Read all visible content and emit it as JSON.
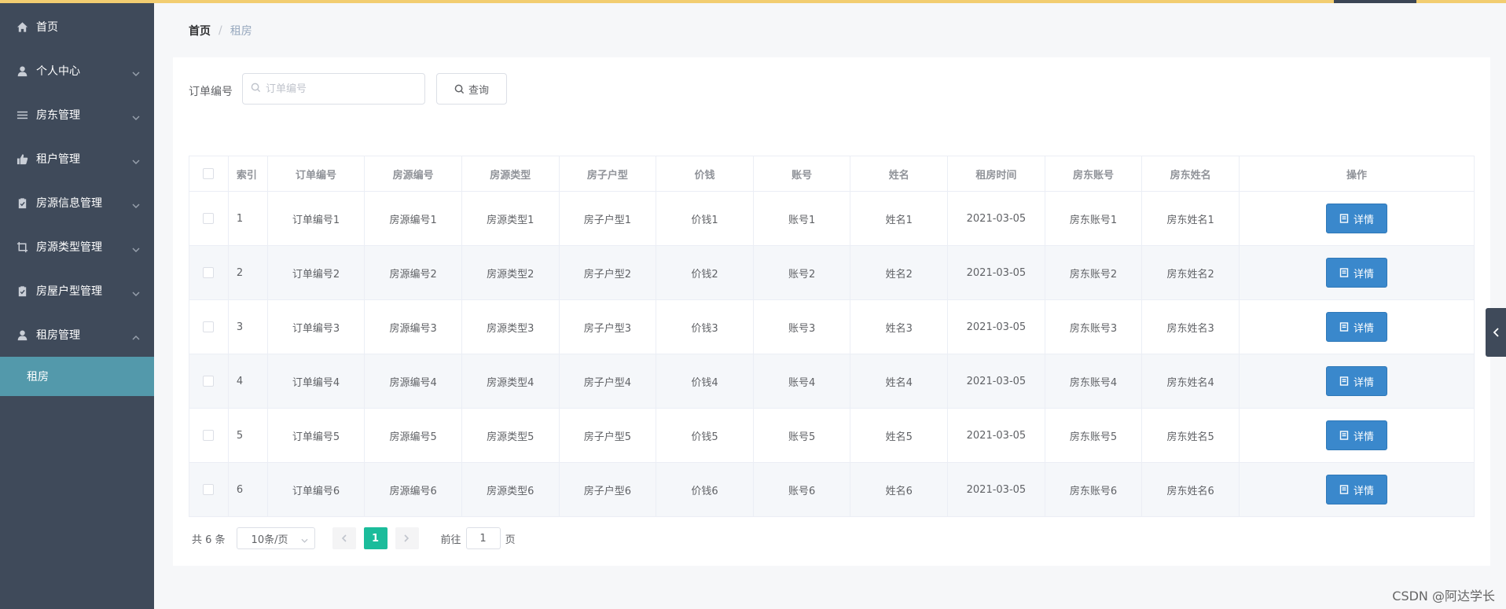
{
  "colors": {
    "sidebar_bg": "#3f4a5a",
    "active_submenu_bg": "#5399ab",
    "accent_green": "#1bbc9b",
    "detail_button": "#3a88cc",
    "top_bar": "#f2cd71"
  },
  "sidebar": {
    "items": [
      {
        "label": "首页",
        "icon": "home-icon",
        "expandable": false
      },
      {
        "label": "个人中心",
        "icon": "user-icon",
        "expandable": true,
        "expanded": false
      },
      {
        "label": "房东管理",
        "icon": "list-icon",
        "expandable": true,
        "expanded": false
      },
      {
        "label": "租户管理",
        "icon": "thumbs-up-icon",
        "expandable": true,
        "expanded": false
      },
      {
        "label": "房源信息管理",
        "icon": "clipboard-icon",
        "expandable": true,
        "expanded": false
      },
      {
        "label": "房源类型管理",
        "icon": "crop-icon",
        "expandable": true,
        "expanded": false
      },
      {
        "label": "房屋户型管理",
        "icon": "clipboard-icon",
        "expandable": true,
        "expanded": false
      },
      {
        "label": "租房管理",
        "icon": "user-icon",
        "expandable": true,
        "expanded": true
      }
    ],
    "submenu": {
      "label": "租房",
      "active": true
    }
  },
  "breadcrumb": {
    "home": "首页",
    "separator": "/",
    "current": "租房"
  },
  "search": {
    "label": "订单编号",
    "placeholder": "订单编号",
    "value": "",
    "button_label": "查询"
  },
  "table": {
    "headers": [
      "索引",
      "订单编号",
      "房源编号",
      "房源类型",
      "房子户型",
      "价钱",
      "账号",
      "姓名",
      "租房时间",
      "房东账号",
      "房东姓名",
      "操作"
    ],
    "rows": [
      [
        "1",
        "订单编号1",
        "房源编号1",
        "房源类型1",
        "房子户型1",
        "价钱1",
        "账号1",
        "姓名1",
        "2021-03-05",
        "房东账号1",
        "房东姓名1"
      ],
      [
        "2",
        "订单编号2",
        "房源编号2",
        "房源类型2",
        "房子户型2",
        "价钱2",
        "账号2",
        "姓名2",
        "2021-03-05",
        "房东账号2",
        "房东姓名2"
      ],
      [
        "3",
        "订单编号3",
        "房源编号3",
        "房源类型3",
        "房子户型3",
        "价钱3",
        "账号3",
        "姓名3",
        "2021-03-05",
        "房东账号3",
        "房东姓名3"
      ],
      [
        "4",
        "订单编号4",
        "房源编号4",
        "房源类型4",
        "房子户型4",
        "价钱4",
        "账号4",
        "姓名4",
        "2021-03-05",
        "房东账号4",
        "房东姓名4"
      ],
      [
        "5",
        "订单编号5",
        "房源编号5",
        "房源类型5",
        "房子户型5",
        "价钱5",
        "账号5",
        "姓名5",
        "2021-03-05",
        "房东账号5",
        "房东姓名5"
      ],
      [
        "6",
        "订单编号6",
        "房源编号6",
        "房源类型6",
        "房子户型6",
        "价钱6",
        "账号6",
        "姓名6",
        "2021-03-05",
        "房东账号6",
        "房东姓名6"
      ]
    ],
    "action_label": "详情"
  },
  "pagination": {
    "total_text": "共 6 条",
    "page_size": "10条/页",
    "current_page": "1",
    "goto_prefix": "前往",
    "goto_value": "1",
    "goto_suffix": "页"
  },
  "watermark": "CSDN @阿达学长"
}
